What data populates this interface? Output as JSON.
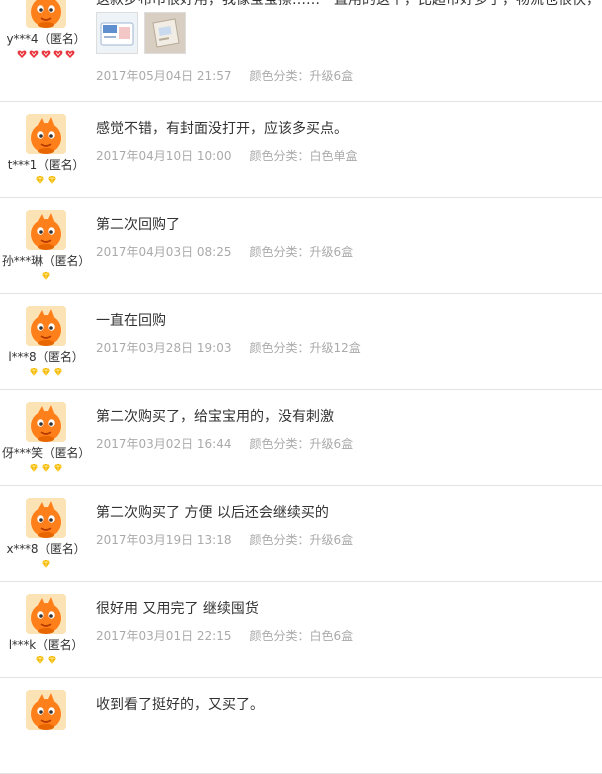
{
  "reviews": [
    {
      "username": "y***4（匿名）",
      "level": {
        "icon": "red-heart-icon",
        "count": 5,
        "color": "#e8343d"
      },
      "comment": "这款步布巾很好用，我像宝宝擦……一直用的这个，比超市好多了，物流也很快，不错",
      "photos": [
        {
          "icon": "product-photo-wipes-pack"
        },
        {
          "icon": "product-photo-box"
        }
      ],
      "date": "2017年05月04日 21:57",
      "sku_label": "颜色分类：",
      "sku_value": "升级6盒"
    },
    {
      "username": "t***1（匿名）",
      "level": {
        "icon": "yellow-diamond-icon",
        "count": 2,
        "color": "#f5b800"
      },
      "comment": "感觉不错，有封面没打开，应该多买点。",
      "date": "2017年04月10日 10:00",
      "sku_label": "颜色分类：",
      "sku_value": "白色单盒"
    },
    {
      "username": "孙***琳（匿名）",
      "level": {
        "icon": "yellow-diamond-icon",
        "count": 1,
        "color": "#f5b800"
      },
      "comment": "第二次回购了",
      "date": "2017年04月03日 08:25",
      "sku_label": "颜色分类：",
      "sku_value": "升级6盒"
    },
    {
      "username": "l***8（匿名）",
      "level": {
        "icon": "yellow-diamond-icon",
        "count": 3,
        "color": "#f5b800"
      },
      "comment": "一直在回购",
      "date": "2017年03月28日 19:03",
      "sku_label": "颜色分类：",
      "sku_value": "升级12盒"
    },
    {
      "username": "伢***笑（匿名）",
      "level": {
        "icon": "yellow-diamond-icon",
        "count": 3,
        "color": "#f5b800"
      },
      "comment": "第二次购买了，给宝宝用的，没有刺激",
      "date": "2017年03月02日 16:44",
      "sku_label": "颜色分类：",
      "sku_value": "升级6盒"
    },
    {
      "username": "x***8（匿名）",
      "level": {
        "icon": "yellow-diamond-icon",
        "count": 1,
        "color": "#f5b800"
      },
      "comment": "第二次购买了 方便 以后还会继续买的",
      "date": "2017年03月19日 13:18",
      "sku_label": "颜色分类：",
      "sku_value": "升级6盒"
    },
    {
      "username": "l***k（匿名）",
      "level": {
        "icon": "yellow-diamond-icon",
        "count": 2,
        "color": "#f5b800"
      },
      "comment": "很好用 又用完了 继续囤货",
      "date": "2017年03月01日 22:15",
      "sku_label": "颜色分类：",
      "sku_value": "白色6盒"
    },
    {
      "username": "",
      "level": {
        "icon": "yellow-diamond-icon",
        "count": 0,
        "color": "#f5b800"
      },
      "comment": "收到看了挺好的，又买了。",
      "date": "",
      "sku_label": "",
      "sku_value": ""
    }
  ],
  "colors": {
    "avatar_orange": "#ff7f1a",
    "meta_gray": "#aaaaaa",
    "divider": "#e3e3e3"
  }
}
